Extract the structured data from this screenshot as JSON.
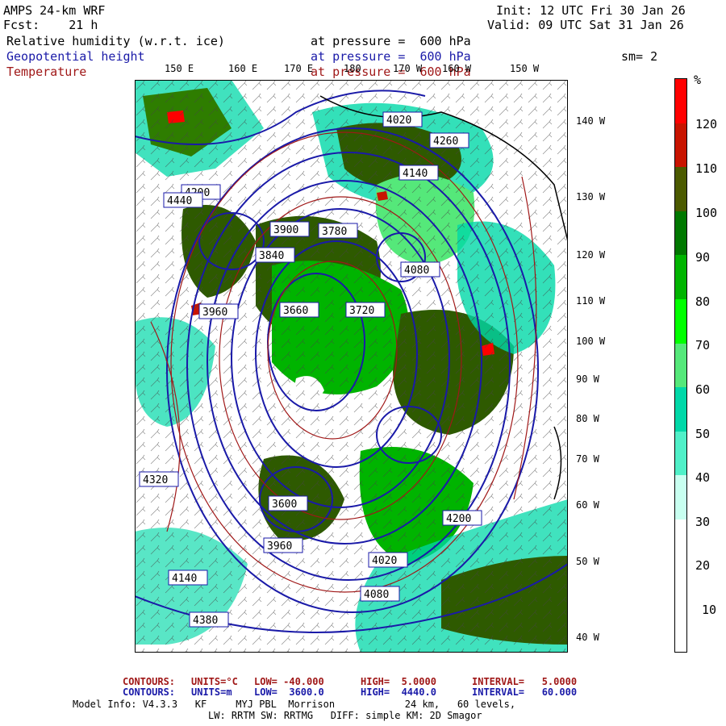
{
  "header": {
    "model": "AMPS 24-km WRF",
    "fcst": "Fcst:    21 h",
    "init": "Init: 12 UTC Fri 30 Jan 26",
    "valid": "Valid: 09 UTC Sat 31 Jan 26",
    "fields": [
      {
        "name": "Relative humidity (w.r.t. ice)",
        "pressure": "at pressure =  600 hPa",
        "color": "#000000"
      },
      {
        "name": "Geopotential height",
        "pressure": "at pressure =  600 hPa",
        "color": "#1a1aa8"
      },
      {
        "name": "Temperature",
        "pressure": "at pressure =  600 hPa",
        "color": "#a01818"
      }
    ],
    "sm": "sm= 2"
  },
  "map": {
    "lon_labels": [
      "150 E",
      "160 E",
      "170 E",
      "180",
      "170 W",
      "160 W",
      "150 W"
    ],
    "lat_labels": [
      "140 W",
      "130 W",
      "120 W",
      "110 W",
      "100 W",
      "90 W",
      "80 W",
      "70 W",
      "60 W",
      "50 W",
      "40 W"
    ],
    "contour_labels": [
      "4080",
      "4020",
      "4260",
      "4200",
      "4140",
      "3900",
      "3840",
      "3780",
      "3720",
      "3660",
      "3960",
      "4320",
      "4380",
      "4440",
      "3600",
      "4200",
      "4140",
      "4080",
      "4020",
      "3960"
    ],
    "colors": {
      "land_green": "#2e5a00",
      "heights": "#1a1aa8",
      "temps": "#a01818"
    }
  },
  "colorbar": {
    "unit": "%",
    "labels": [
      "120",
      "110",
      "100",
      "90",
      "80",
      "70",
      "60",
      "50",
      "40",
      "30",
      "20",
      "10"
    ],
    "segments": [
      "#ff0000",
      "#c81400",
      "#4b5a00",
      "#007800",
      "#00b400",
      "#00ff00",
      "#55e87a",
      "#00d8a8",
      "#50f0c8",
      "#c8fff0",
      "#ffffff",
      "#ffffff",
      "#ffffff"
    ]
  },
  "footer": {
    "temp_contours": {
      "label": "CONTOURS:",
      "units": "UNITS=°C",
      "low": "LOW= -40.000",
      "high": "HIGH=  5.0000",
      "interval": "INTERVAL=   5.0000"
    },
    "height_contours": {
      "label": "CONTOURS:",
      "units": "UNITS=m",
      "low": "LOW=  3600.0",
      "high": "HIGH=  4440.0",
      "interval": "INTERVAL=   60.000"
    },
    "model_info_1": "Model Info: V4.3.3   KF     MYJ PBL  Morrison            24 km,   60 levels,",
    "model_info_2": "LW: RRTM SW: RRTMG   DIFF: simple KM: 2D Smagor"
  }
}
